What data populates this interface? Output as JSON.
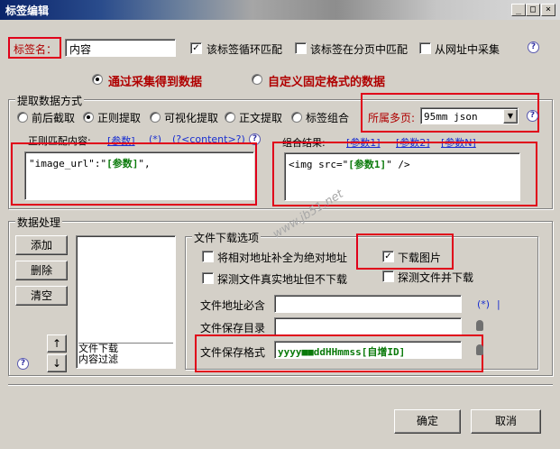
{
  "window": {
    "title": "标签编辑",
    "min": "_",
    "max": "□",
    "close": "×"
  },
  "top": {
    "label_name": "标签名：",
    "label_value": "内容",
    "loop_match": "该标签循环匹配",
    "loop_match_checked": true,
    "paginate_match": "该标签在分页中匹配",
    "paginate_match_checked": false,
    "from_url": "从网址中采集",
    "from_url_checked": false
  },
  "source": {
    "collect": "通过采集得到数据",
    "custom": "自定义固定格式的数据",
    "selected": "collect"
  },
  "extract": {
    "group_title": "提取数据方式",
    "modes": [
      "前后截取",
      "正则提取",
      "可视化提取",
      "正文提取",
      "标签组合"
    ],
    "selected_mode": 1,
    "multipage_label": "所属多页:",
    "multipage_value": "95mm json",
    "regex_label": "正则匹配内容:",
    "regex_links": [
      "[参数]",
      "(*)",
      "(?<content>?)"
    ],
    "regex_prefix": "\"image_url\":\"",
    "regex_param": "[参数]",
    "regex_suffix": "\",",
    "combine_label": "组合结果:",
    "combine_links": [
      "[参数1]",
      "[参数2]",
      "[参数N]"
    ],
    "combine_prefix": "<img src=\"",
    "combine_param": "[参数1]",
    "combine_suffix": "\" />"
  },
  "processing": {
    "group_title": "数据处理",
    "add": "添加",
    "delete": "删除",
    "clear": "清空",
    "up": "↑",
    "down": "↓",
    "list_items": [
      "文件下载",
      "内容过滤"
    ]
  },
  "download": {
    "group_title": "文件下载选项",
    "relative_to_absolute": "将相对地址补全为绝对地址",
    "relative_to_absolute_checked": false,
    "download_images": "下载图片",
    "download_images_checked": true,
    "probe_no_download": "探测文件真实地址但不下载",
    "probe_no_download_checked": false,
    "probe_and_download": "探测文件并下载",
    "probe_and_download_checked": false,
    "url_must_contain": "文件地址必含",
    "save_dir": "文件保存目录",
    "save_format": "文件保存格式",
    "save_format_value": "yyyy■■ddHHmmss[自增ID]",
    "wildcard": "(*)",
    "bar": "|"
  },
  "footer": {
    "ok": "确定",
    "cancel": "取消"
  },
  "watermark": "www.jb51.net"
}
